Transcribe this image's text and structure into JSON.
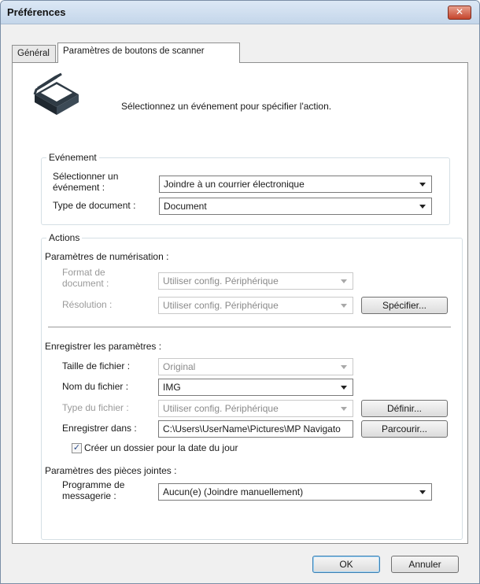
{
  "window": {
    "title": "Préférences",
    "close_glyph": "✕"
  },
  "tabs": [
    {
      "label": "Général"
    },
    {
      "label": "Paramètres de boutons de scanner"
    }
  ],
  "intro": {
    "text": "Sélectionnez un événement pour spécifier l'action.",
    "icon": "scanner-icon"
  },
  "event": {
    "legend": "Evénement",
    "select_event_label_line1": "Sélectionner un",
    "select_event_label_line2": "événement :",
    "select_event_value": "Joindre à un courrier électronique",
    "doc_type_label": "Type de document :",
    "doc_type_value": "Document"
  },
  "actions": {
    "legend": "Actions",
    "scan_settings": {
      "heading": "Paramètres de numérisation :",
      "doc_format_label_line1": "Format de",
      "doc_format_label_line2": "document :",
      "doc_format_value": "Utiliser config. Périphérique",
      "resolution_label": "Résolution :",
      "resolution_value": "Utiliser config. Périphérique",
      "specify_button": "Spécifier..."
    },
    "save_settings": {
      "heading": "Enregistrer les paramètres :",
      "file_size_label": "Taille de fichier :",
      "file_size_value": "Original",
      "file_name_label": "Nom du fichier :",
      "file_name_value": "IMG",
      "file_type_label": "Type du fichier :",
      "file_type_value": "Utiliser config. Périphérique",
      "define_button": "Définir...",
      "save_in_label": "Enregistrer dans :",
      "save_in_value": "C:\\Users\\UserName\\Pictures\\MP Navigato",
      "browse_button": "Parcourir...",
      "create_folder_checked": true,
      "create_folder_label": "Créer un dossier pour la date du jour",
      "check_glyph": "✓"
    },
    "attachments": {
      "heading": "Paramètres des pièces jointes :",
      "program_label_line1": "Programme de",
      "program_label_line2": "messagerie :",
      "program_value": "Aucun(e) (Joindre manuellement)"
    }
  },
  "footer": {
    "ok": "OK",
    "cancel": "Annuler"
  }
}
